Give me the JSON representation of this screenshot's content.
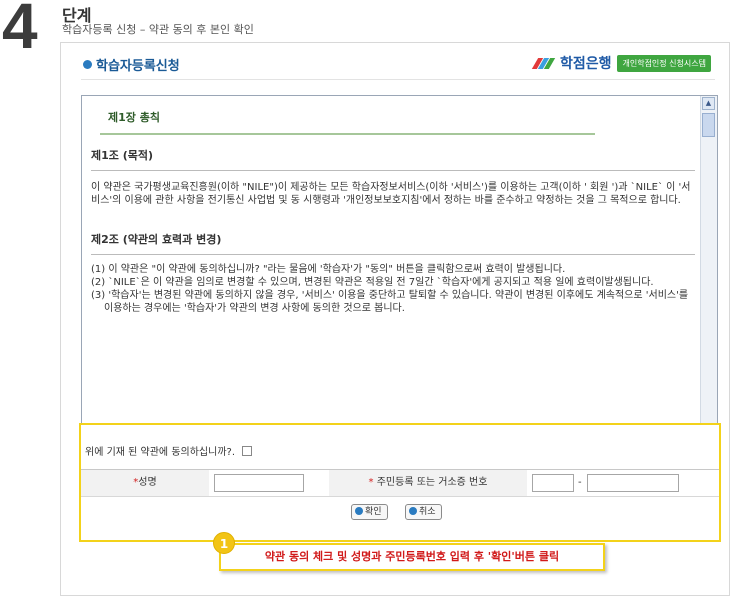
{
  "step": {
    "number": "4",
    "word": "단계",
    "subtitle": "학습자등록 신청 – 약관 동의 후 본인 확인"
  },
  "panel": {
    "title": "학습자등록신청",
    "logo_text": "학점은행",
    "logo_badge": "개인학점인정 신청시스템"
  },
  "terms": {
    "chapter": "제1장 총칙",
    "article1_title": "제1조 (목적)",
    "article1_body": "이 약관은 국가평생교육진흥원(이하 \"NILE\")이 제공하는 모든 학습자정보서비스(이하 '서비스')를 이용하는 고객(이하 ' 회원 ')과 `NILE` 이 '서비스'의 이용에 관한 사항을 전기통신 사업법 및 동 시행령과 '개인정보보호지침'에서 정하는 바를 준수하고 약정하는 것을 그 목적으로 합니다.",
    "article2_title": "제2조 (약관의 효력과 변경)",
    "clauses": [
      "(1) 이 약관은 \"이 약관에 동의하십니까? \"라는 물음에 '학습자'가 \"동의\" 버튼을 클릭함으로써 효력이 발생됩니다.",
      "(2) `NILE`은 이 약관을 임의로 변경할 수 있으며, 변경된 약관은 적용일 전 7일간 `학습자'에게 공지되고 적용 일에 효력이발생됩니다.",
      "(3) '학습자'는 변경된 약관에 동의하지 않을 경우, '서비스' 이용을 중단하고 탈퇴할 수 있습니다. 약관이 변경된 이후에도 계속적으로 '서비스'를 이용하는 경우에는 '학습자'가 약관의 변경 사항에 동의한 것으로 봅니다."
    ]
  },
  "agree": {
    "question": "위에 기재 된 약관에 동의하십니까?.",
    "checked": false,
    "name_required_mark": "*",
    "name_label": "성명",
    "id_required_mark": "*",
    "id_label": "주민등록 또는 거소증 번호",
    "name_value": "",
    "id_front_value": "",
    "id_back_value": "",
    "id_dash": "-",
    "confirm_label": "확인",
    "cancel_label": "취소"
  },
  "annotation": {
    "number": "1",
    "text": "약관 동의 체크 및 성명과 주민등록번호 입력 후 '확인'버튼 클릭"
  },
  "colors": {
    "highlight": "#f3d21a",
    "callout_text": "#d11a1a",
    "title_blue": "#1a5a96"
  }
}
